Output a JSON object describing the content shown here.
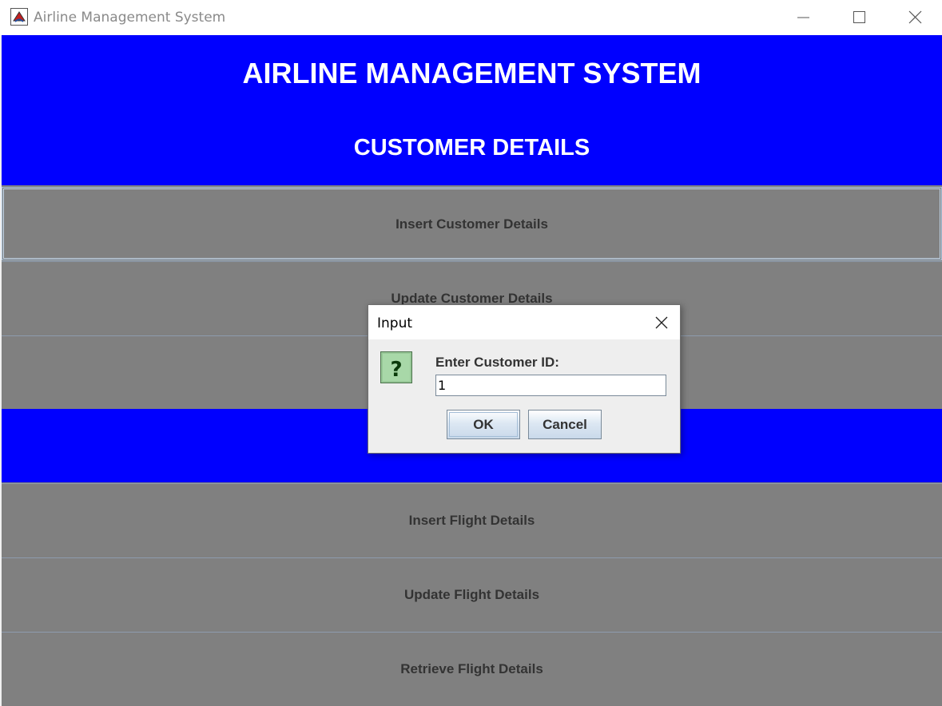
{
  "window": {
    "title": "Airline Management System",
    "controls": {
      "minimize_icon": "minimize-icon",
      "maximize_icon": "maximize-icon",
      "close_icon": "close-icon"
    }
  },
  "main": {
    "title": "AIRLINE MANAGEMENT SYSTEM",
    "customer_section": {
      "heading": "CUSTOMER DETAILS",
      "buttons": [
        {
          "label": "Insert Customer Details"
        },
        {
          "label": "Update Customer Details"
        },
        {
          "label": ""
        }
      ]
    },
    "flight_section": {
      "heading": "",
      "buttons": [
        {
          "label": "Insert Flight Details"
        },
        {
          "label": "Update Flight Details"
        },
        {
          "label": "Retrieve Flight Details"
        }
      ]
    }
  },
  "dialog": {
    "title": "Input",
    "prompt": "Enter Customer ID:",
    "input_value": "1",
    "ok_label": "OK",
    "cancel_label": "Cancel",
    "icon": "question-icon"
  },
  "colors": {
    "header_blue": "#0000ff",
    "button_gray": "#808080",
    "heading_text": "#ffffff"
  }
}
